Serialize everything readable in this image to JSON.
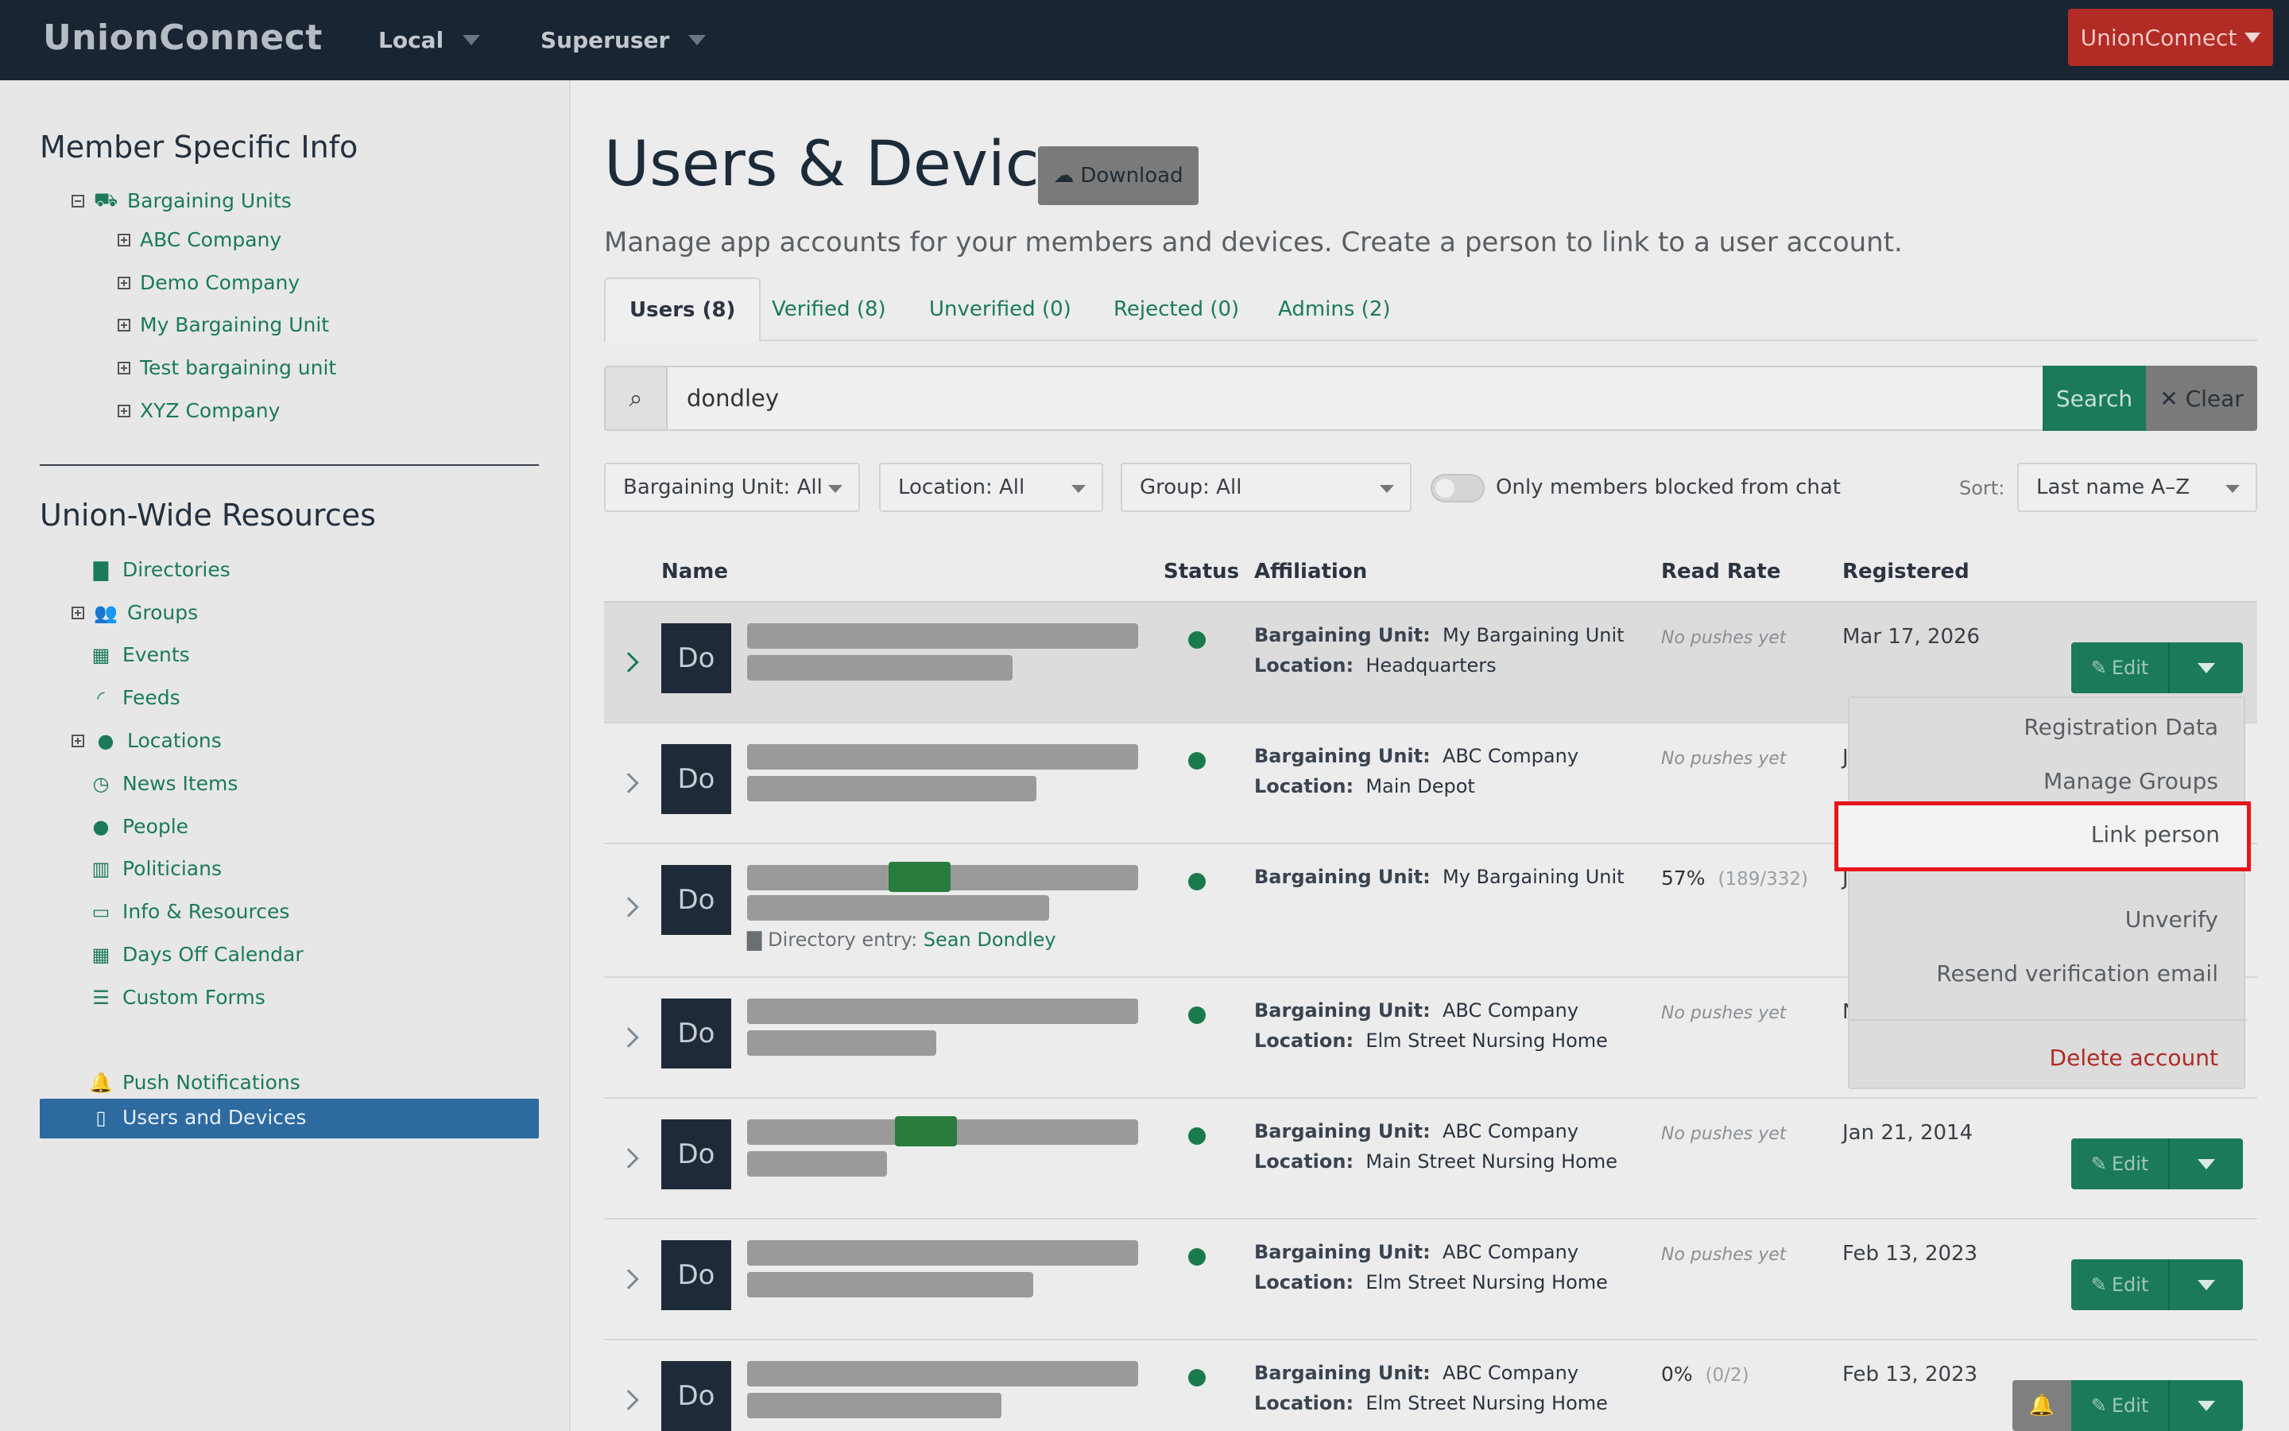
{
  "nav": {
    "brand": "UnionConnect",
    "local": "Local",
    "superuser": "Superuser",
    "account_button": "UnionConnect"
  },
  "sidebar": {
    "member_heading": "Member Specific Info",
    "bargaining_root": "Bargaining Units",
    "bargaining_units": [
      "ABC Company",
      "Demo Company",
      "My Bargaining Unit",
      "Test bargaining unit",
      "XYZ Company"
    ],
    "union_heading": "Union-Wide Resources",
    "resources": [
      {
        "label": "Directories",
        "icon": "book-icon"
      },
      {
        "label": "Groups",
        "icon": "users-icon"
      },
      {
        "label": "Events",
        "icon": "calendar-icon"
      },
      {
        "label": "Feeds",
        "icon": "rss-icon"
      },
      {
        "label": "Locations",
        "icon": "globe-icon"
      },
      {
        "label": "News Items",
        "icon": "clock-icon"
      },
      {
        "label": "People",
        "icon": "person-icon"
      },
      {
        "label": "Politicians",
        "icon": "building-icon"
      },
      {
        "label": "Info & Resources",
        "icon": "folder-icon"
      },
      {
        "label": "Days Off Calendar",
        "icon": "calendar-icon"
      },
      {
        "label": "Custom Forms",
        "icon": "list-icon"
      },
      {
        "label": "Users and Devices",
        "icon": "tablet-icon"
      },
      {
        "label": "Push Notifications",
        "icon": "bell-icon"
      }
    ]
  },
  "main": {
    "title": "Users & Devices",
    "download": "Download",
    "subtitle": "Manage app accounts for your members and devices. Create a person to link to a user account.",
    "tabs": [
      "Users (8)",
      "Verified (8)",
      "Unverified (0)",
      "Rejected (0)",
      "Admins (2)"
    ],
    "search_value": "dondley",
    "search_button": "Search",
    "clear_button": "✕ Clear",
    "filters": {
      "bargaining_unit": "Bargaining Unit: All",
      "location": "Location: All",
      "group": "Group: All",
      "blocked_toggle": "Only members blocked from chat",
      "sort_label": "Sort:",
      "sort_value": "Last name A–Z"
    },
    "columns": [
      "Name",
      "Status",
      "Affiliation",
      "Read Rate",
      "Registered"
    ],
    "affiliation_labels": {
      "unit": "Bargaining Unit:",
      "location": "Location:"
    },
    "rows": [
      {
        "avatar": "Do",
        "unit": "My Bargaining Unit",
        "location": "Headquarters",
        "read": "No pushes yet",
        "registered": "Mar 17, 2026"
      },
      {
        "avatar": "Do",
        "unit": "ABC Company",
        "location": "Main Depot",
        "read": "No pushes yet",
        "registered": "J"
      },
      {
        "avatar": "Do",
        "unit": "My Bargaining Unit",
        "location": "",
        "read_pct": "57%",
        "read_frac": "(189/332)",
        "registered": "J",
        "directory_label": "Directory entry:",
        "directory_name": "Sean Dondley"
      },
      {
        "avatar": "Do",
        "unit": "ABC Company",
        "location": "Elm Street Nursing Home",
        "read": "No pushes yet",
        "registered": "N"
      },
      {
        "avatar": "Do",
        "unit": "ABC Company",
        "location": "Main Street Nursing Home",
        "read": "No pushes yet",
        "registered": "Jan 21, 2014"
      },
      {
        "avatar": "Do",
        "unit": "ABC Company",
        "location": "Elm Street Nursing Home",
        "read": "No pushes yet",
        "registered": "Feb 13, 2023"
      },
      {
        "avatar": "Do",
        "unit": "ABC Company",
        "location": "Elm Street Nursing Home",
        "read_pct": "0%",
        "read_frac": "(0/2)",
        "registered": "Feb 13, 2023"
      }
    ],
    "edit_label": "Edit",
    "menu": {
      "registration": "Registration Data",
      "manage_groups": "Manage Groups",
      "link_person": "Link person",
      "unverify": "Unverify",
      "resend": "Resend verification email",
      "delete": "Delete account"
    }
  },
  "colors": {
    "nav": "#1a2533",
    "accent": "#1b7a5c",
    "danger": "#b22b25",
    "highlight": "#e8141a"
  }
}
